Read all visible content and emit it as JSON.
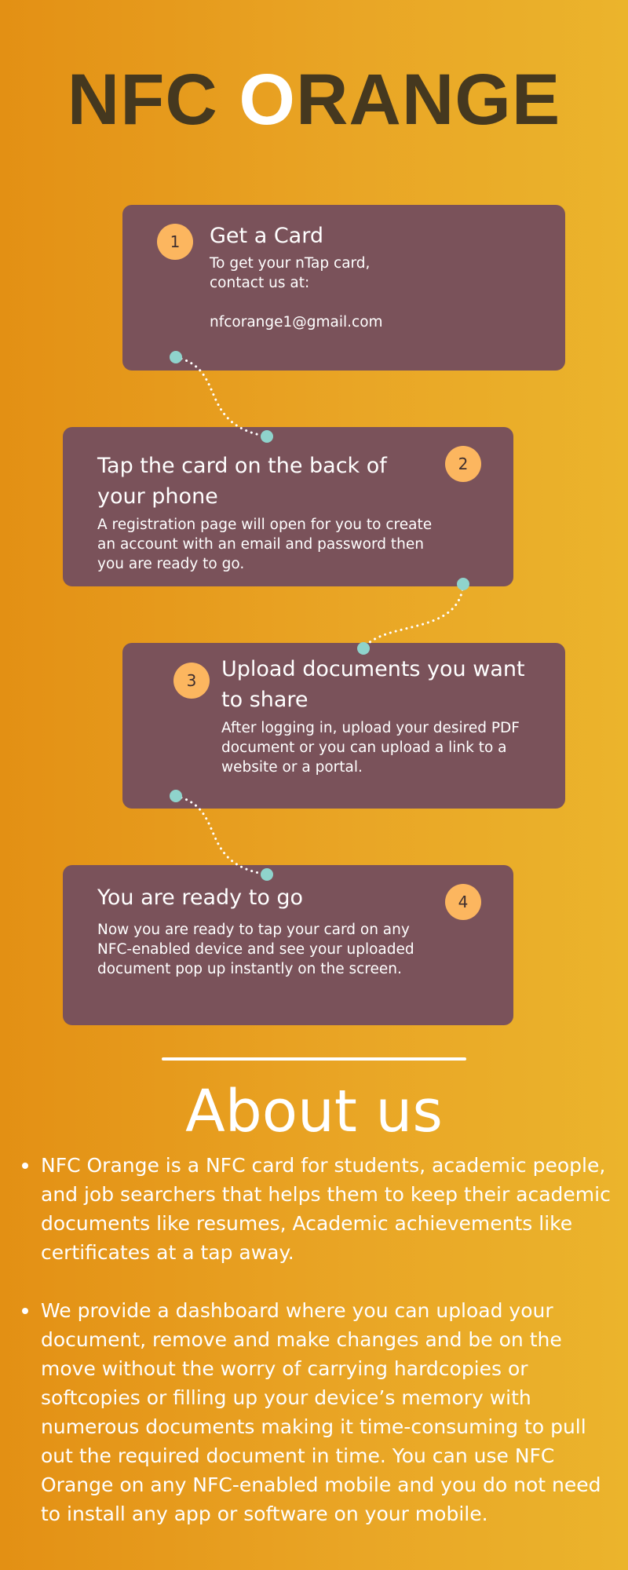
{
  "header": {
    "title_part1": "NFC ",
    "title_o": "O",
    "title_part2": "RANGE"
  },
  "steps": [
    {
      "number": "1",
      "title": "Get a Card",
      "body_line1": "To get your nTap card,",
      "body_line2": "contact us at:",
      "email": "nfcorange1@gmail.com"
    },
    {
      "number": "2",
      "title": "Tap the card on the back of your phone",
      "body": "A registration page will open for you to create an account with an email and password then you are ready to go."
    },
    {
      "number": "3",
      "title": "Upload documents you want to share",
      "body": "After logging in, upload your desired PDF document or you can upload a link to a website or a portal."
    },
    {
      "number": "4",
      "title": "You are ready to go",
      "body": "Now you are ready to tap your card on any NFC-enabled device and see your uploaded document pop up instantly on the screen."
    }
  ],
  "about": {
    "heading": "About us",
    "items": [
      "NFC Orange is a NFC card for students, academic people, and job searchers that helps them to keep their academic documents like resumes, Academic achievements like certificates at a tap away.",
      "We provide a dashboard where you can upload your document, remove and make changes and be on the move without the worry of carrying hardcopies or softcopies or filling up your device’s memory with numerous documents making it time-consuming to pull out the required document in time. You can use NFC Orange on any NFC-enabled mobile and you do not need to install any app or software on your mobile."
    ]
  },
  "colors": {
    "card": "#7a525a",
    "badge": "#fcb65f",
    "connector_dot": "#8fd3cc",
    "title_dark": "#45381f"
  }
}
